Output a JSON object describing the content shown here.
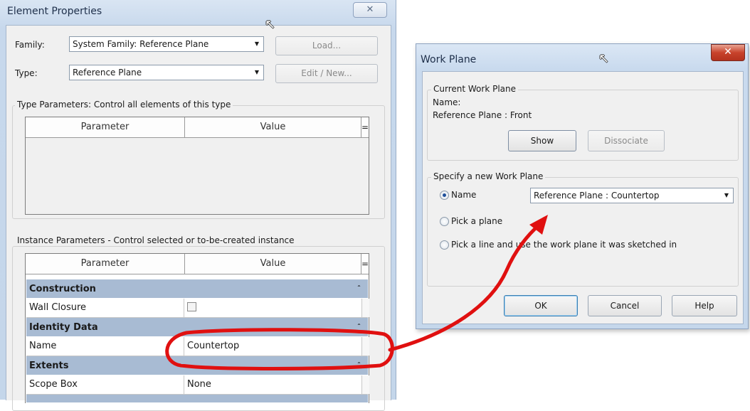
{
  "element_properties": {
    "title": "Element Properties",
    "close_label": "✕",
    "family_label": "Family:",
    "family_value": "System Family: Reference Plane",
    "type_label": "Type:",
    "type_value": "Reference Plane",
    "load_button": "Load...",
    "edit_new_button": "Edit / New...",
    "type_params_title": "Type Parameters: Control all elements of this type",
    "instance_params_title": "Instance Parameters - Control selected or to-be-created instance",
    "col_parameter": "Parameter",
    "col_value": "Value",
    "col_eq": "=",
    "categories": [
      {
        "name": "Construction",
        "rows": [
          {
            "param": "Wall Closure",
            "value": ""
          }
        ]
      },
      {
        "name": "Identity Data",
        "rows": [
          {
            "param": "Name",
            "value": "Countertop"
          }
        ]
      },
      {
        "name": "Extents",
        "rows": [
          {
            "param": "Scope Box",
            "value": "None"
          }
        ]
      }
    ]
  },
  "work_plane": {
    "title": "Work Plane",
    "close_label": "✕",
    "current_group_title": "Current Work Plane",
    "name_label": "Name:",
    "current_name": "Reference Plane : Front",
    "show_button": "Show",
    "dissociate_button": "Dissociate",
    "specify_group_title": "Specify a new Work Plane",
    "option_name": "Name",
    "option_name_value": "Reference Plane : Countertop",
    "option_pick_plane": "Pick a plane",
    "option_pick_line": "Pick a line and use the work plane it was sketched in",
    "selected_option": "name",
    "ok_button": "OK",
    "cancel_button": "Cancel",
    "help_button": "Help"
  },
  "annotation": {
    "highlight_color": "#e01010"
  }
}
